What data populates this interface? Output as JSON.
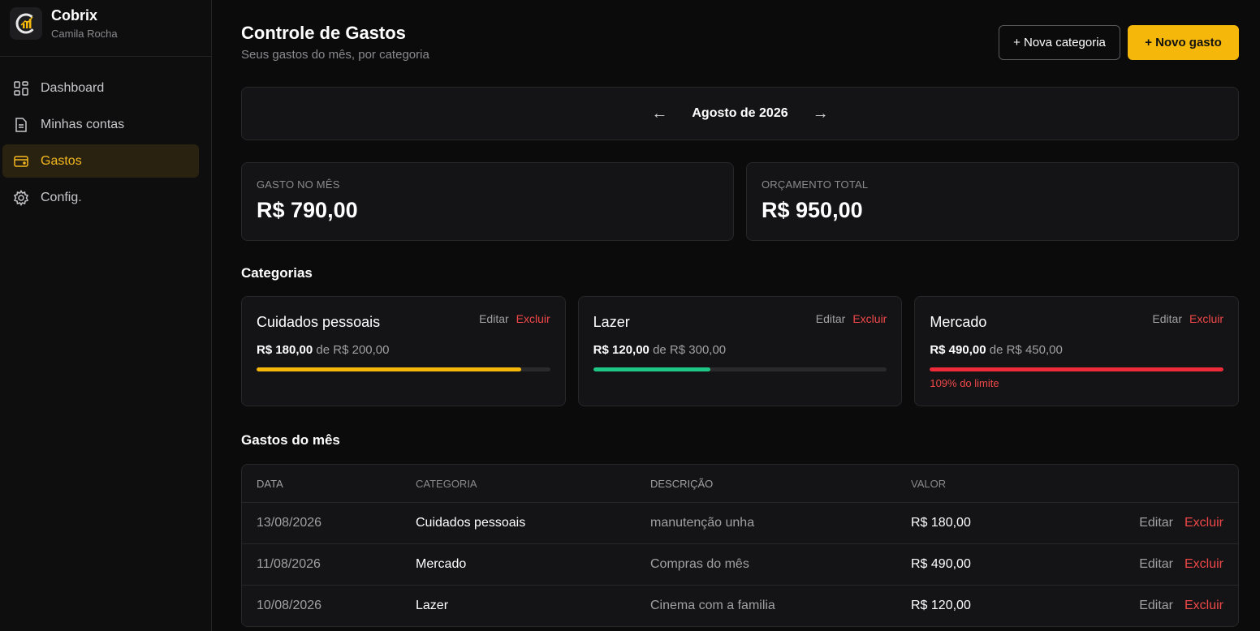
{
  "app": {
    "name": "Cobrix",
    "user": "Camila Rocha"
  },
  "sidebar": {
    "items": [
      {
        "label": "Dashboard",
        "icon": "grid-icon"
      },
      {
        "label": "Minhas contas",
        "icon": "document-icon"
      },
      {
        "label": "Gastos",
        "icon": "wallet-icon",
        "active": true
      },
      {
        "label": "Config.",
        "icon": "gear-icon"
      }
    ]
  },
  "header": {
    "title": "Controle de Gastos",
    "subtitle": "Seus gastos do mês, por categoria",
    "new_category_label": "+ Nova categoria",
    "new_expense_label": "+ Novo gasto"
  },
  "month": {
    "label": "Agosto de 2026",
    "prev": "←",
    "next": "→"
  },
  "stats": [
    {
      "label": "GASTO NO MÊS",
      "value": "R$ 790,00"
    },
    {
      "label": "ORÇAMENTO TOTAL",
      "value": "R$ 950,00"
    }
  ],
  "categories_title": "Categorias",
  "categories": [
    {
      "name": "Cuidados pessoais",
      "spent": "R$ 180,00",
      "of": "de R$ 200,00",
      "progress": 0.9,
      "color": "#f5b80a",
      "warning": ""
    },
    {
      "name": "Lazer",
      "spent": "R$ 120,00",
      "of": "de R$ 300,00",
      "progress": 0.4,
      "color": "#1fc787",
      "warning": ""
    },
    {
      "name": "Mercado",
      "spent": "R$ 490,00",
      "of": "de R$ 450,00",
      "progress": 1.0,
      "color": "#ef2b3a",
      "warning": "109% do limite"
    }
  ],
  "actions": {
    "edit": "Editar",
    "delete": "Excluir"
  },
  "expenses_title": "Gastos do mês",
  "table": {
    "headers": [
      "DATA",
      "CATEGORIA",
      "DESCRIÇÃO",
      "VALOR"
    ],
    "rows": [
      {
        "date": "13/08/2026",
        "category": "Cuidados pessoais",
        "description": "manutenção unha",
        "value": "R$ 180,00"
      },
      {
        "date": "11/08/2026",
        "category": "Mercado",
        "description": "Compras do mês",
        "value": "R$ 490,00"
      },
      {
        "date": "10/08/2026",
        "category": "Lazer",
        "description": "Cinema com a familia",
        "value": "R$ 120,00"
      }
    ]
  }
}
